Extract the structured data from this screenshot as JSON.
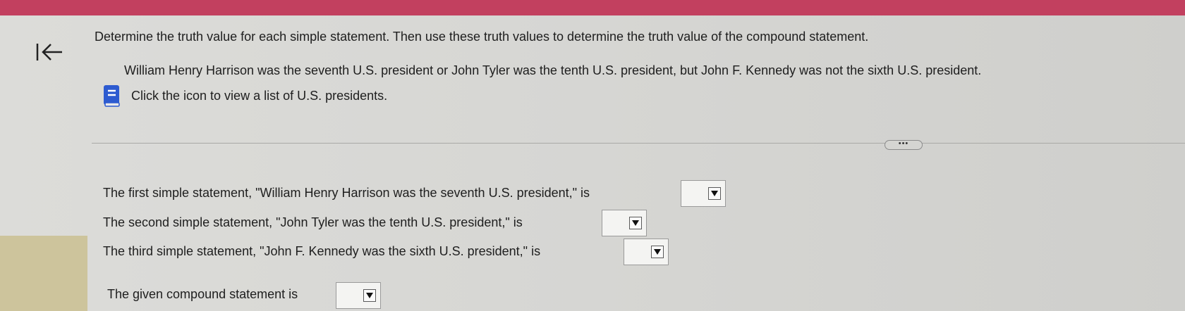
{
  "header": {
    "bar_color": "#c2405f"
  },
  "nav": {
    "back_icon": "back-arrow-icon"
  },
  "question": {
    "instruction": "Determine the truth value for each simple statement. Then use these truth values to determine the truth value of the compound statement.",
    "statement": "William Henry Harrison was the seventh U.S. president or John Tyler was the tenth U.S. president, but John F. Kennedy was not the sixth U.S. president.",
    "icon_note": "Click the icon to view a list of U.S. presidents.",
    "icon": "book-icon"
  },
  "more_button": {
    "label": "•••"
  },
  "answers": {
    "first": {
      "text": "The first simple statement, \"William Henry Harrison was the seventh U.S. president,\" is",
      "value": ""
    },
    "second": {
      "text": "The second simple statement, \"John Tyler was the tenth U.S. president,\" is",
      "value": ""
    },
    "third": {
      "text": "The third simple statement, \"John F. Kennedy was the sixth U.S. president,\" is",
      "value": ""
    },
    "compound": {
      "text": "The given compound statement is",
      "value": ""
    }
  }
}
